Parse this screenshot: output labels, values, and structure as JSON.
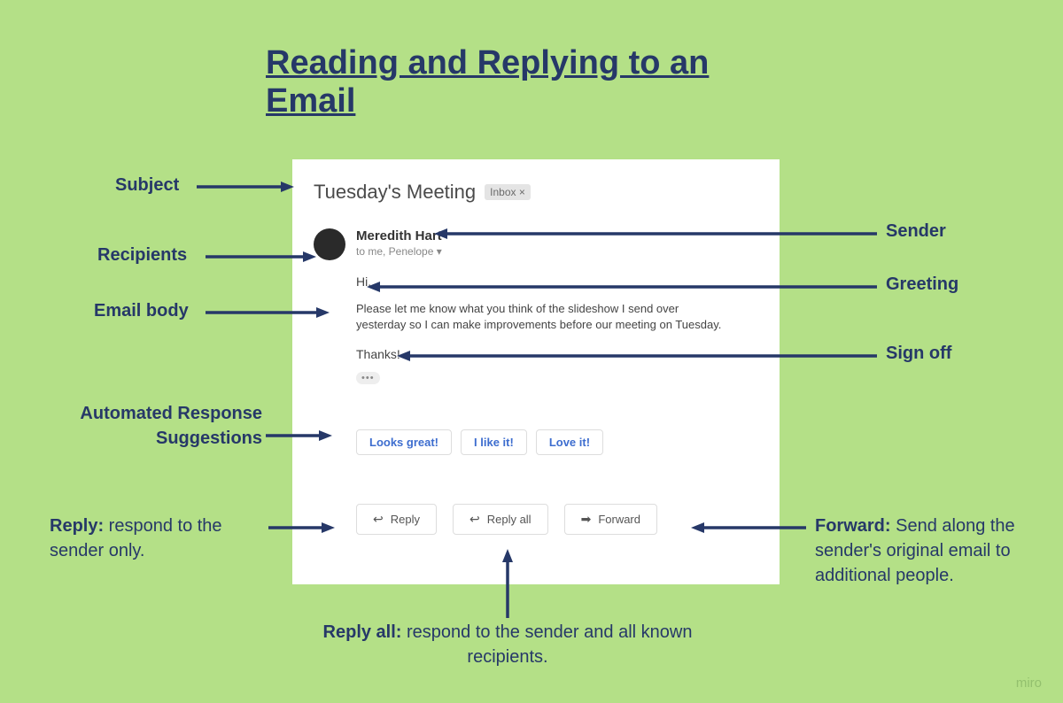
{
  "title": "Reading and Replying to an Email",
  "email": {
    "subject": "Tuesday's Meeting",
    "inbox_chip": "Inbox ×",
    "sender_name": "Meredith Hart",
    "recipients": "to me, Penelope ▾",
    "greeting": "Hi,",
    "body": "Please let me know what you think of the slideshow I send over yesterday so I can make improvements before our meeting on Tuesday.",
    "signoff": "Thanks!",
    "dots": "•••"
  },
  "suggestions": [
    "Looks great!",
    "I like it!",
    "Love it!"
  ],
  "actions": {
    "reply": "Reply",
    "reply_all": "Reply all",
    "forward": "Forward"
  },
  "labels": {
    "subject": "Subject",
    "recipients": "Recipients",
    "email_body": "Email body",
    "auto_response_l1": "Automated Response",
    "auto_response_l2": "Suggestions",
    "sender": "Sender",
    "greeting": "Greeting",
    "signoff": "Sign off",
    "reply_bold": "Reply:",
    "reply_desc": " respond to the sender only.",
    "replyall_bold": "Reply all:",
    "replyall_desc": " respond to the sender and all known recipients.",
    "forward_bold": "Forward:",
    "forward_desc": " Send along the sender's original email to additional people."
  },
  "watermark": "miro"
}
